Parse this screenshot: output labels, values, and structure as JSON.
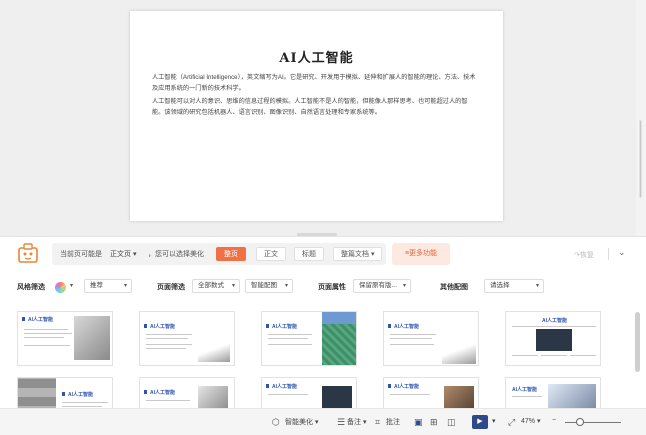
{
  "slide": {
    "title": "AI人工智能",
    "para1": "人工智能（Artificial Intelligence），英文缩写为AI。它是研究、开发用于模拟、延伸和扩展人的智能的理论、方法、技术及应用系统的一门新的技术科学。",
    "para2": "人工智能可以对人的意识、思维的信息过程的模拟。人工智能不是人的智能，但能像人那样思考、也可能超过人的智能。该领域的研究包括机器人、语言识别、图像识别、自然语言处理和专家系统等。"
  },
  "beautify_bar": {
    "hint_prefix": "当前页可能是",
    "page_type": "正文页",
    "hint_suffix": "，您可以选择美化",
    "chips": [
      "整页",
      "正文",
      "标题",
      "整篇文档"
    ],
    "active_chip": "整页",
    "more_button": "≡更多功能",
    "redo": "↷恢复"
  },
  "filters": {
    "style_label": "风格筛选",
    "style_value": "推荐",
    "layout_label": "页面筛选",
    "layout_count": "全部数式",
    "layout_match": "智能配图",
    "attr_label": "页面属性",
    "attr_value": "保留原有版...",
    "other_label": "其他配图",
    "other_value": "请选择"
  },
  "thumbnails": [
    {
      "title": "AI人工智能"
    },
    {
      "title": "AI人工智能"
    },
    {
      "title": "AI人工智能"
    },
    {
      "title": "AI人工智能"
    },
    {
      "title": "AI人工智能"
    },
    {
      "title": "AI人工智能"
    },
    {
      "title": "AI人工智能"
    },
    {
      "title": "AI人工智能"
    },
    {
      "title": "AI人工智能"
    },
    {
      "title": "AI人工智能"
    }
  ],
  "statusbar": {
    "smart_beautify": "智能美化",
    "notes": "备注",
    "comments": "批注",
    "zoom": "47%"
  }
}
